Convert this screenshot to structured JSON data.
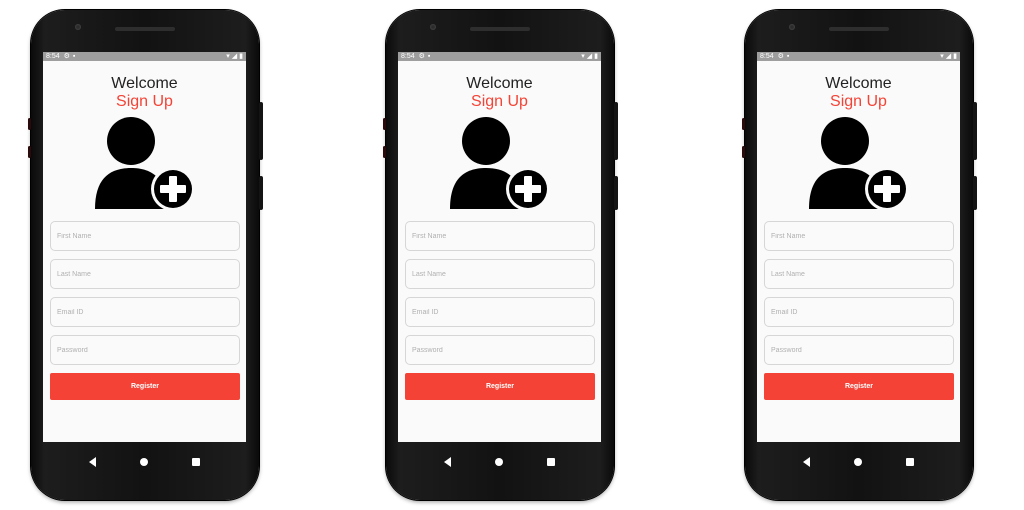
{
  "screens": [
    {
      "status": {
        "time": "8:54"
      },
      "welcome": "Welcome",
      "signup": "Sign Up",
      "fields": {
        "first_name": "First Name",
        "last_name": "Last Name",
        "email": "Email ID",
        "password": "Password"
      },
      "register_label": "Register"
    },
    {
      "status": {
        "time": "8:54"
      },
      "welcome": "Welcome",
      "signup": "Sign Up",
      "fields": {
        "first_name": "First Name",
        "last_name": "Last Name",
        "email": "Email ID",
        "password": "Password"
      },
      "register_label": "Register"
    },
    {
      "status": {
        "time": "8:54"
      },
      "welcome": "Welcome",
      "signup": "Sign Up",
      "fields": {
        "first_name": "First Name",
        "last_name": "Last Name",
        "email": "Email ID",
        "password": "Password"
      },
      "register_label": "Register"
    }
  ],
  "colors": {
    "accent": "#f44336",
    "status_bar": "#9e9e9e",
    "screen_bg": "#fafafa",
    "phone_body": "#121212"
  },
  "icons": {
    "avatar": "add-user-icon",
    "nav_back": "back-triangle-icon",
    "nav_home": "home-circle-icon",
    "nav_recent": "recents-square-icon"
  }
}
